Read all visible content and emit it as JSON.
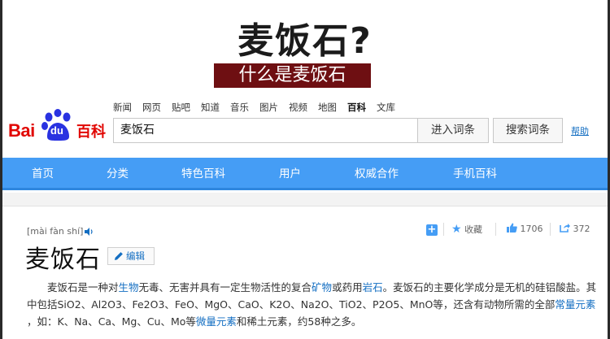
{
  "banner": {
    "title": "麦饭石?",
    "subtitle": "什么是麦饭石"
  },
  "logo": {
    "bai": "Bai",
    "du": "du",
    "baike": "百科"
  },
  "top_links": [
    "新闻",
    "网页",
    "贴吧",
    "知道",
    "音乐",
    "图片",
    "视频",
    "地图",
    "百科",
    "文库"
  ],
  "top_links_active": "百科",
  "search": {
    "value": "麦饭石",
    "enter_label": "进入词条",
    "search_label": "搜索词条",
    "help_label": "帮助"
  },
  "nav": {
    "items": [
      "首页",
      "分类",
      "特色百科",
      "用户",
      "权威合作",
      "手机百科"
    ]
  },
  "entry": {
    "pinyin": "[mài fàn shí]",
    "title": "麦饭石",
    "edit_label": "编辑",
    "collect_label": "收藏",
    "like_count": "1706",
    "share_count": "372"
  },
  "paragraph": {
    "l1_a": "麦饭石是一种对",
    "l1_link1": "生物",
    "l1_b": "无毒、无害并具有一定生物活性的复合",
    "l1_link2": "矿物",
    "l1_c": "或药用",
    "l1_link3": "岩石",
    "l1_d": "。麦饭石的主要化学成分是无机的硅铝酸盐。其",
    "l2_a": "中包括SiO2、Al2O3、Fe2O3、FeO、MgO、CaO、K2O、Na2O、TiO2、P2O5、MnO等，还含有动物所需的全部",
    "l2_link": "常量元素",
    "l3_a": "，如：K、Na、Ca、Mg、Cu、Mo等",
    "l3_link": "微量元素",
    "l3_b": "和稀土元素，约58种之多。"
  },
  "colors": {
    "nav_blue": "#459df5",
    "banner_red": "#6e0f12",
    "brand_red": "#e10602",
    "link_blue": "#136ec2"
  }
}
